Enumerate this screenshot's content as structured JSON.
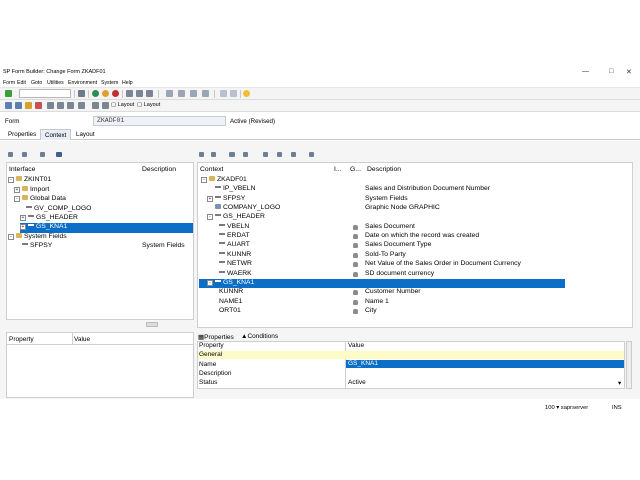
{
  "window": {
    "title": "SP Form Builder: Change Form ZKADF01"
  },
  "menu": [
    "Form",
    "Edit",
    "Goto",
    "Utilities",
    "Environment",
    "System",
    "Help"
  ],
  "toolbar2": {
    "layout_label_1": "Layout",
    "layout_label_2": "Layout"
  },
  "form": {
    "label": "Form",
    "value": "ZKADF01",
    "status": "Active (Revised)"
  },
  "tabs": [
    "Properties",
    "Context",
    "Layout"
  ],
  "interface_pane": {
    "col_interface": "Interface",
    "col_description": "Description",
    "tree": [
      {
        "label": "ZKINT01",
        "desc": ""
      },
      {
        "label": "Import",
        "desc": ""
      },
      {
        "label": "Global Data",
        "desc": ""
      },
      {
        "label": "GV_COMP_LOGO",
        "desc": ""
      },
      {
        "label": "GS_HEADER",
        "desc": ""
      },
      {
        "label": "GS_KNA1",
        "desc": ""
      },
      {
        "label": "System Fields",
        "desc": ""
      },
      {
        "label": "SFPSY",
        "desc": "System Fields"
      }
    ]
  },
  "left_props": {
    "col_property": "Property",
    "col_value": "Value"
  },
  "context_pane": {
    "col_context": "Context",
    "col_i": "I...",
    "col_g": "G...",
    "col_description": "Description",
    "tree": [
      {
        "label": "ZKADF01",
        "desc": ""
      },
      {
        "label": "IP_VBELN",
        "desc": "Sales and Distribution Document Number"
      },
      {
        "label": "SFPSY",
        "desc": "System Fields"
      },
      {
        "label": "COMPANY_LOGO",
        "desc": "Graphic Node GRAPHIC"
      },
      {
        "label": "GS_HEADER",
        "desc": ""
      },
      {
        "label": "VBELN",
        "desc": "Sales Document"
      },
      {
        "label": "ERDAT",
        "desc": "Date on which the record was created"
      },
      {
        "label": "AUART",
        "desc": "Sales Document Type"
      },
      {
        "label": "KUNNR",
        "desc": "Sold-To Party"
      },
      {
        "label": "NETWR",
        "desc": "Net Value of the Sales Order in Document Currency"
      },
      {
        "label": "WAERK",
        "desc": "SD document currency"
      },
      {
        "label": "GS_KNA1",
        "desc": ""
      },
      {
        "label": "KUNNR",
        "desc": "Customer Number"
      },
      {
        "label": "NAME1",
        "desc": "Name 1"
      },
      {
        "label": "ORT01",
        "desc": "City"
      }
    ]
  },
  "bottom_tabs": {
    "properties": "Properties",
    "conditions": "Conditions"
  },
  "right_props": {
    "col_property": "Property",
    "col_value": "Value",
    "section": "General",
    "rows": [
      {
        "name": "Name",
        "value": "GS_KNA1"
      },
      {
        "name": "Description",
        "value": ""
      },
      {
        "name": "Status",
        "value": "Active"
      }
    ]
  },
  "statusbar": {
    "server": "100 ▾ saprserver",
    "mode": "INS"
  },
  "colors": {
    "selection": "#0b6fc8",
    "accent": "#e8eef7"
  }
}
